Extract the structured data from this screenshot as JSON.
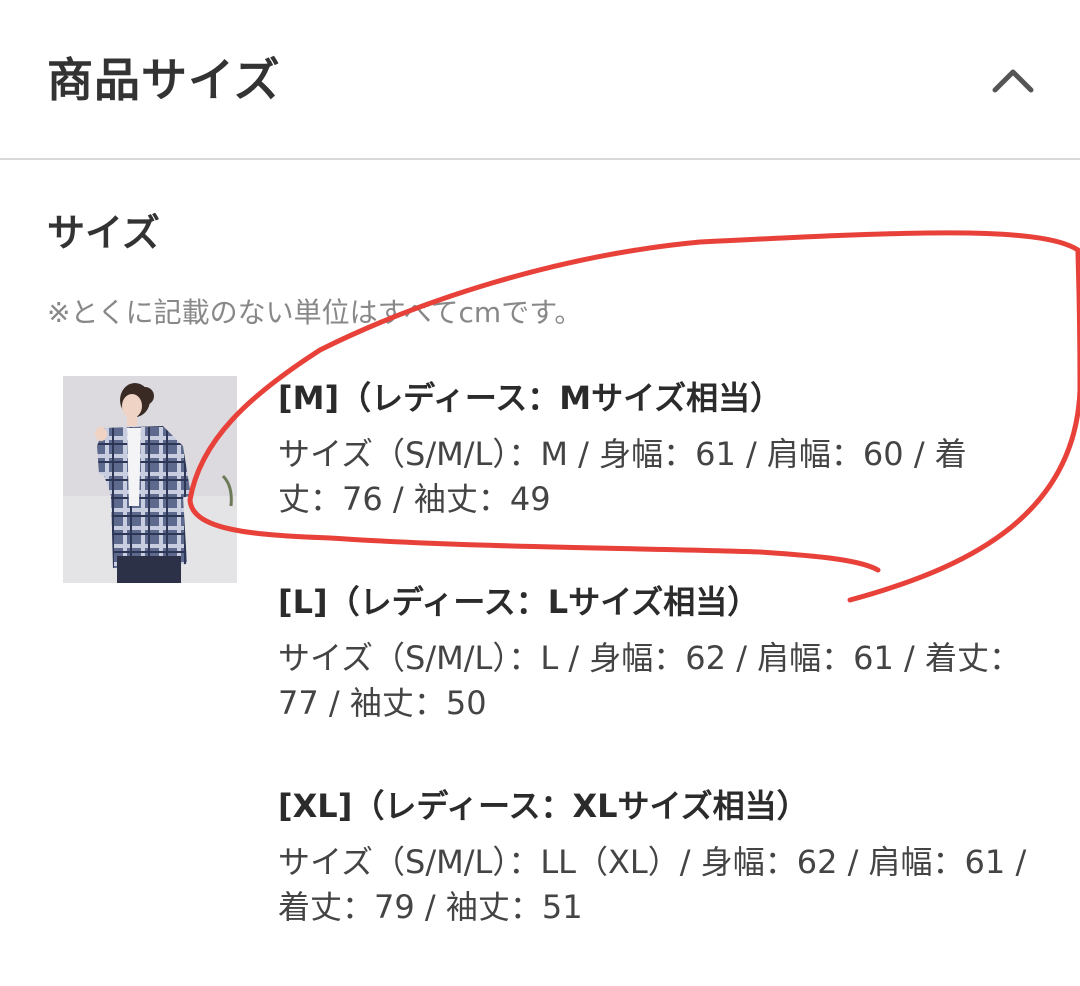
{
  "header": {
    "title": "商品サイズ"
  },
  "section": {
    "title": "サイズ",
    "note": "※とくに記載のない単位はすべてcmです。"
  },
  "sizes": [
    {
      "heading": "[M]（レディース：Mサイズ相当）",
      "detail": "サイズ（S/M/L）：M / 身幅：61 / 肩幅：60 / 着丈：76 / 袖丈：49"
    },
    {
      "heading": "[L]（レディース：Lサイズ相当）",
      "detail": "サイズ（S/M/L）：L / 身幅：62 / 肩幅：61 / 着丈：77 / 袖丈：50"
    },
    {
      "heading": "[XL]（レディース：XLサイズ相当）",
      "detail": "サイズ（S/M/L）：LL（XL）/ 身幅：62 / 肩幅：61 / 着丈：79 / 袖丈：51"
    }
  ],
  "icons": {
    "collapse": "chevron-up-icon"
  },
  "colors": {
    "annotation_stroke": "#e8413a",
    "divider": "#d9d9d9",
    "note_text": "#888888"
  }
}
